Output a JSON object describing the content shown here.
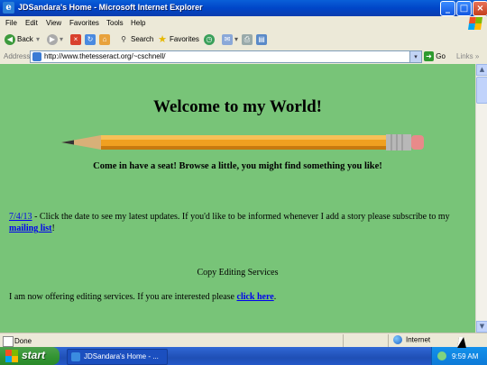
{
  "window": {
    "title": "JDSandara's Home - Microsoft Internet Explorer",
    "app_icon": "ie-icon",
    "controls": {
      "minimize": "_",
      "maximize": "□",
      "close": "×"
    }
  },
  "menu": {
    "items": [
      "File",
      "Edit",
      "View",
      "Favorites",
      "Tools",
      "Help"
    ]
  },
  "toolbar": {
    "back_label": "Back",
    "search_label": "Search",
    "favorites_label": "Favorites"
  },
  "address": {
    "label": "Address",
    "url": "http://www.thetesseract.org/~cschnell/",
    "go_label": "Go",
    "links_label": "Links"
  },
  "page": {
    "heading": "Welcome to my World!",
    "tagline": "Come in have a seat! Browse a little, you might find something you like!",
    "update_date": "7/4/13",
    "update_text_1": " - Click the date to see my latest updates. If you'd like to be informed whenever I add a story please subscribe to my ",
    "mailing_list_link": "mailing list",
    "update_text_2": "!",
    "editing_title": "Copy Editing Services",
    "editing_text": "I am now offering editing services. If you are interested please ",
    "click_here_link": "click here",
    "editing_end": ".",
    "background_color": "#78C478",
    "link_color": "#0000EE"
  },
  "status": {
    "text": "Done",
    "zone": "Internet"
  },
  "taskbar": {
    "start_label": "start",
    "task_label": "JDSandara's Home - ...",
    "clock": "9:59 AM"
  }
}
